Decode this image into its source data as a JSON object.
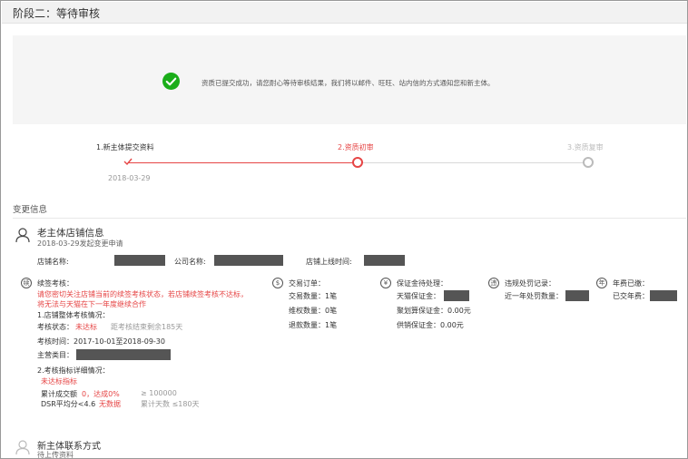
{
  "header": {
    "title": "阶段二：等待审核"
  },
  "notice": {
    "message": "资质已提交成功，请您耐心等待审核结果，我们将以邮件、旺旺、站内信的方式通知您和新主体。"
  },
  "steps": [
    {
      "label": "1.新主体提交资料",
      "date": "2018-03-29",
      "status": "done"
    },
    {
      "label": "2.资质初审",
      "status": "active"
    },
    {
      "label": "3.资质复审",
      "status": "pending"
    }
  ],
  "change_info": {
    "section_title": "变更信息",
    "old_store": {
      "title": "老主体店铺信息",
      "request_date": "2018-03-29发起变更申请",
      "store_name_label": "店铺名称:",
      "company_name_label": "公司名称:",
      "online_time_label": "店铺上线时间:"
    },
    "renewal": {
      "icon": "续",
      "title": "续签考核：",
      "warning_line1": "请您密切关注店铺当前的续签考核状态，若店铺续签考核不达标，",
      "warning_line2": "将无法与天猫在下一年度继续合作",
      "overall_label": "1.店铺整体考核情况：",
      "status_label": "考核状态：",
      "status_value": "未达标",
      "countdown": "距考核结束剩余185天",
      "period": "考核时间：2017-10-01至2018-09-30",
      "category_label": "主营类目：",
      "detail_label": "2.考核指标详细情况：",
      "unmet": "未达标指标",
      "gmv_label": "累计成交额",
      "gmv_value": "0，达成0%",
      "gmv_target": "≥ 100000",
      "dsr_label": "DSR平均分<4.6",
      "dsr_value": "无数据",
      "dsr_target": "累计天数 ≤180天"
    },
    "orders": {
      "icon": "$",
      "title": "交易订单：",
      "items": [
        "交易数量：1笔",
        "维权数量：0笔",
        "退款数量：1笔"
      ]
    },
    "deposit": {
      "icon": "¥",
      "title": "保证金待处理：",
      "tmall_label": "天猫保证金：",
      "jhs_label": "聚划算保证金：0.00元",
      "supplier_label": "供销保证金：0.00元"
    },
    "violations": {
      "icon": "违",
      "title": "违规处罚记录：",
      "item": "近一年处罚数量："
    },
    "annual_fee": {
      "icon": "年",
      "title": "年费已缴：",
      "item": "已交年费："
    },
    "new_owner": {
      "title": "新主体联系方式",
      "status": "待上传资料"
    }
  },
  "colors": {
    "accent": "#e64545",
    "success": "#1aad19",
    "mask": "#555555"
  }
}
